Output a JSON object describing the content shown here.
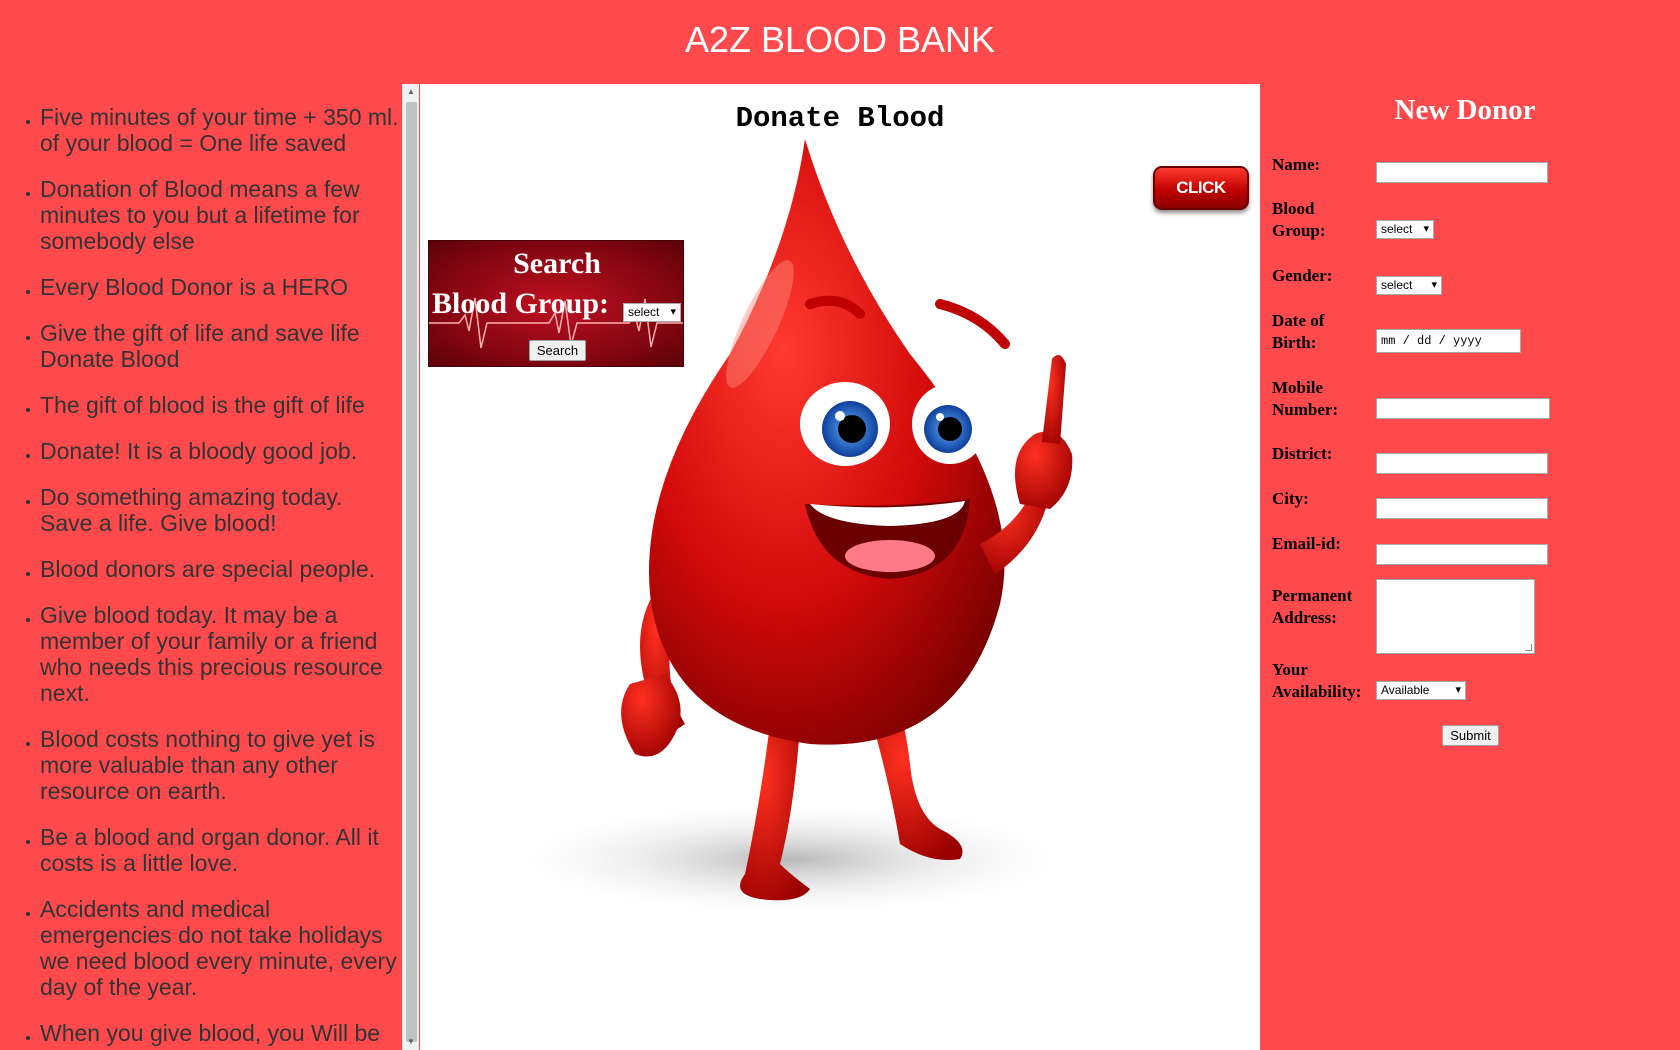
{
  "header": {
    "title": "A2Z BLOOD BANK"
  },
  "quotes": [
    "Five minutes of your time + 350 ml. of your blood = One life saved",
    "Donation of Blood means a few minutes to you but a lifetime for somebody else",
    "Every Blood Donor is a HERO",
    "Give the gift of life and save life Donate Blood",
    "The gift of blood is the gift of life",
    "Donate! It is a bloody good job.",
    "Do something amazing today. Save a life. Give blood!",
    "Blood donors are special people.",
    "Give blood today. It may be a member of your family or a friend who needs this precious resource next.",
    "Blood costs nothing to give yet is more valuable than any other resource on earth.",
    "Be a blood and organ donor. All it costs is a little love.",
    "Accidents and medical emergencies do not take holidays we need blood every minute, every day of the year.",
    "When you give blood, you Will be"
  ],
  "center": {
    "title": "Donate Blood",
    "click_here": "CLICK HERE",
    "search": {
      "title": "Search",
      "label": "Blood Group:",
      "select_value": "select",
      "button": "Search"
    }
  },
  "form": {
    "title": "New Donor",
    "name_label": "Name:",
    "blood_group_label_1": "Blood",
    "blood_group_label_2": "Group:",
    "blood_group_value": "select",
    "gender_label": "Gender:",
    "gender_value": "select",
    "dob_label_1": "Date of",
    "dob_label_2": "Birth:",
    "dob_placeholder": "mm / dd / yyyy",
    "mobile_label_1": "Mobile",
    "mobile_label_2": "Number:",
    "district_label": "District:",
    "city_label": "City:",
    "email_label": "Email-id:",
    "address_label_1": "Permanent",
    "address_label_2": "Address:",
    "availability_label_1": "Your",
    "availability_label_2": "Availability:",
    "availability_value": "Available",
    "submit": "Submit"
  },
  "colors": {
    "background": "#ff4a4d",
    "accent_dark_red": "#b00000"
  },
  "icons": {
    "scroll_up": "triangle-up",
    "scroll_down": "triangle-down"
  }
}
